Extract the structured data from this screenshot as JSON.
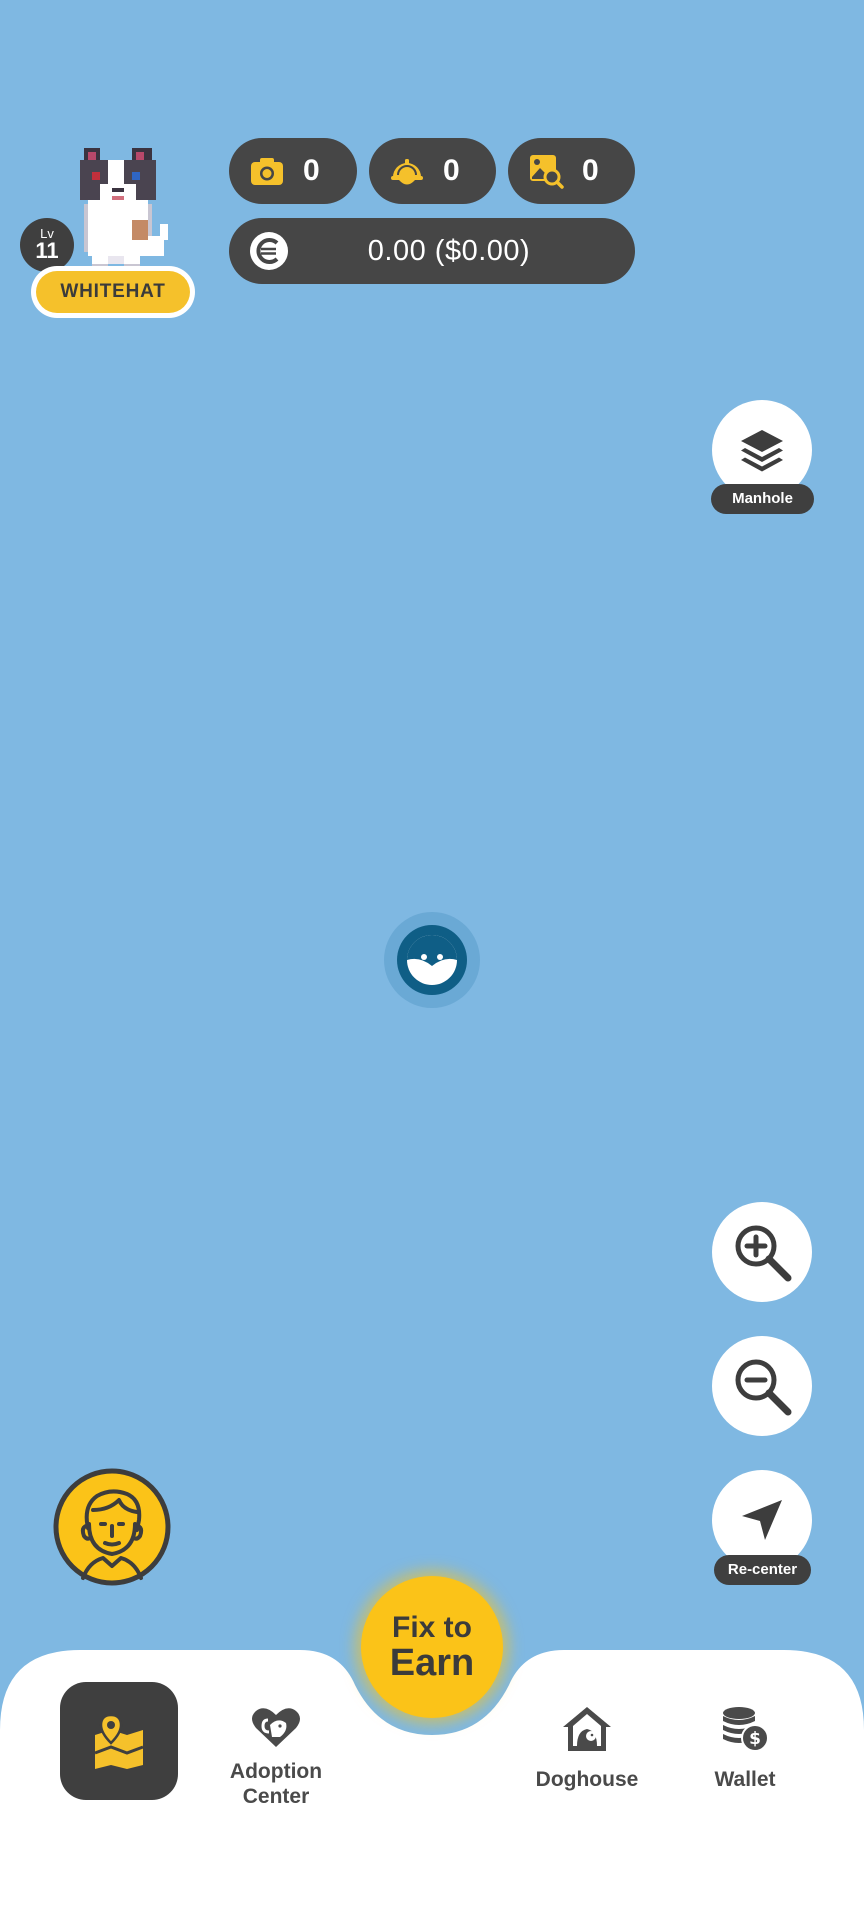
{
  "stats": {
    "photos": "0",
    "helmets": "0",
    "images_found": "0",
    "balance": "0.00 ($0.00)"
  },
  "profile": {
    "level_label": "Lv",
    "level": "11",
    "name": "WHITEHAT"
  },
  "map_controls": {
    "layers_label": "Manhole",
    "recenter_label": "Re-center"
  },
  "center_action": {
    "line1": "Fix to",
    "line2": "Earn"
  },
  "nav": {
    "adoption_line1": "Adoption",
    "adoption_line2": "Center",
    "doghouse": "Doghouse",
    "wallet": "Wallet"
  },
  "colors": {
    "map_background": "#7fb8e2",
    "accent_yellow": "#f5c12b",
    "dark_pill": "#464646",
    "marker": "#0f5e86"
  },
  "icons": [
    "camera-icon",
    "helmet-icon",
    "image-search-icon",
    "coin-icon",
    "layers-icon",
    "zoom-in-icon",
    "zoom-out-icon",
    "navigation-arrow-icon",
    "user-face-icon",
    "map-pin-icon",
    "heart-dog-icon",
    "doghouse-icon",
    "coins-dollar-icon"
  ]
}
